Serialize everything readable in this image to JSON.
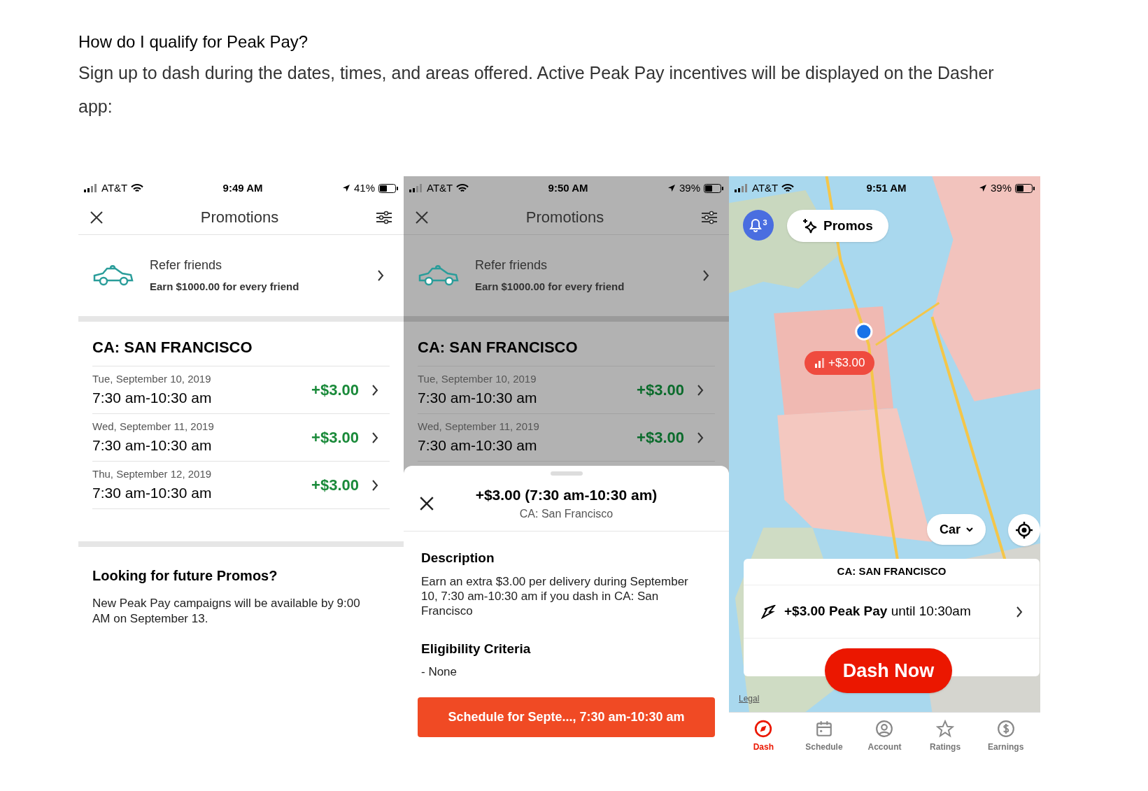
{
  "article": {
    "question": "How do I qualify for Peak Pay?",
    "answer": "Sign up to dash during the dates, times, and areas offered. Active Peak Pay incentives will be displayed on the Dasher app:"
  },
  "screens": [
    {
      "kind": "promotions",
      "dimmed": false,
      "status": {
        "carrier": "AT&T",
        "time": "9:49 AM",
        "battery": "41%"
      },
      "title": "Promotions",
      "refer": {
        "title": "Refer friends",
        "subtitle": "Earn $1000.00 for every friend"
      },
      "region": "CA: SAN FRANCISCO",
      "promos": [
        {
          "date": "Tue, September 10, 2019",
          "time": "7:30 am-10:30 am",
          "amount": "+$3.00"
        },
        {
          "date": "Wed, September 11, 2019",
          "time": "7:30 am-10:30 am",
          "amount": "+$3.00"
        },
        {
          "date": "Thu, September 12, 2019",
          "time": "7:30 am-10:30 am",
          "amount": "+$3.00"
        }
      ],
      "future": {
        "title": "Looking for future Promos?",
        "text": "New Peak Pay campaigns will be available by 9:00 AM on September 13."
      }
    },
    {
      "kind": "promotions",
      "dimmed": true,
      "status": {
        "carrier": "AT&T",
        "time": "9:50 AM",
        "battery": "39%"
      },
      "title": "Promotions",
      "refer": {
        "title": "Refer friends",
        "subtitle": "Earn $1000.00 for every friend"
      },
      "region": "CA: SAN FRANCISCO",
      "promos": [
        {
          "date": "Tue, September 10, 2019",
          "time": "7:30 am-10:30 am",
          "amount": "+$3.00"
        },
        {
          "date": "Wed, September 11, 2019",
          "time": "7:30 am-10:30 am",
          "amount": "+$3.00"
        }
      ],
      "sheet": {
        "title": "+$3.00 (7:30 am-10:30 am)",
        "subtitle": "CA: San Francisco",
        "sections": [
          {
            "heading": "Description",
            "text": "Earn an extra $3.00 per delivery during September 10, 7:30 am-10:30 am if you dash in CA: San Francisco"
          },
          {
            "heading": "Eligibility Criteria",
            "text": "- None"
          }
        ],
        "button": "Schedule for Septe..., 7:30 am-10:30 am"
      }
    },
    {
      "kind": "map",
      "status": {
        "carrier": "AT&T",
        "time": "9:51 AM",
        "battery": "39%"
      },
      "notifications": "3",
      "promos_button": "Promos",
      "map_pin": "+$3.00",
      "car_button": "Car",
      "legal": "Legal",
      "card": {
        "region": "CA: SAN FRANCISCO",
        "offer": "**+$3.00 Peak Pay** until 10:30am"
      },
      "dash_now": "Dash Now",
      "tabs": [
        {
          "label": "Dash",
          "selected": true
        },
        {
          "label": "Schedule",
          "selected": false
        },
        {
          "label": "Account",
          "selected": false
        },
        {
          "label": "Ratings",
          "selected": false
        },
        {
          "label": "Earnings",
          "selected": false
        }
      ]
    }
  ]
}
